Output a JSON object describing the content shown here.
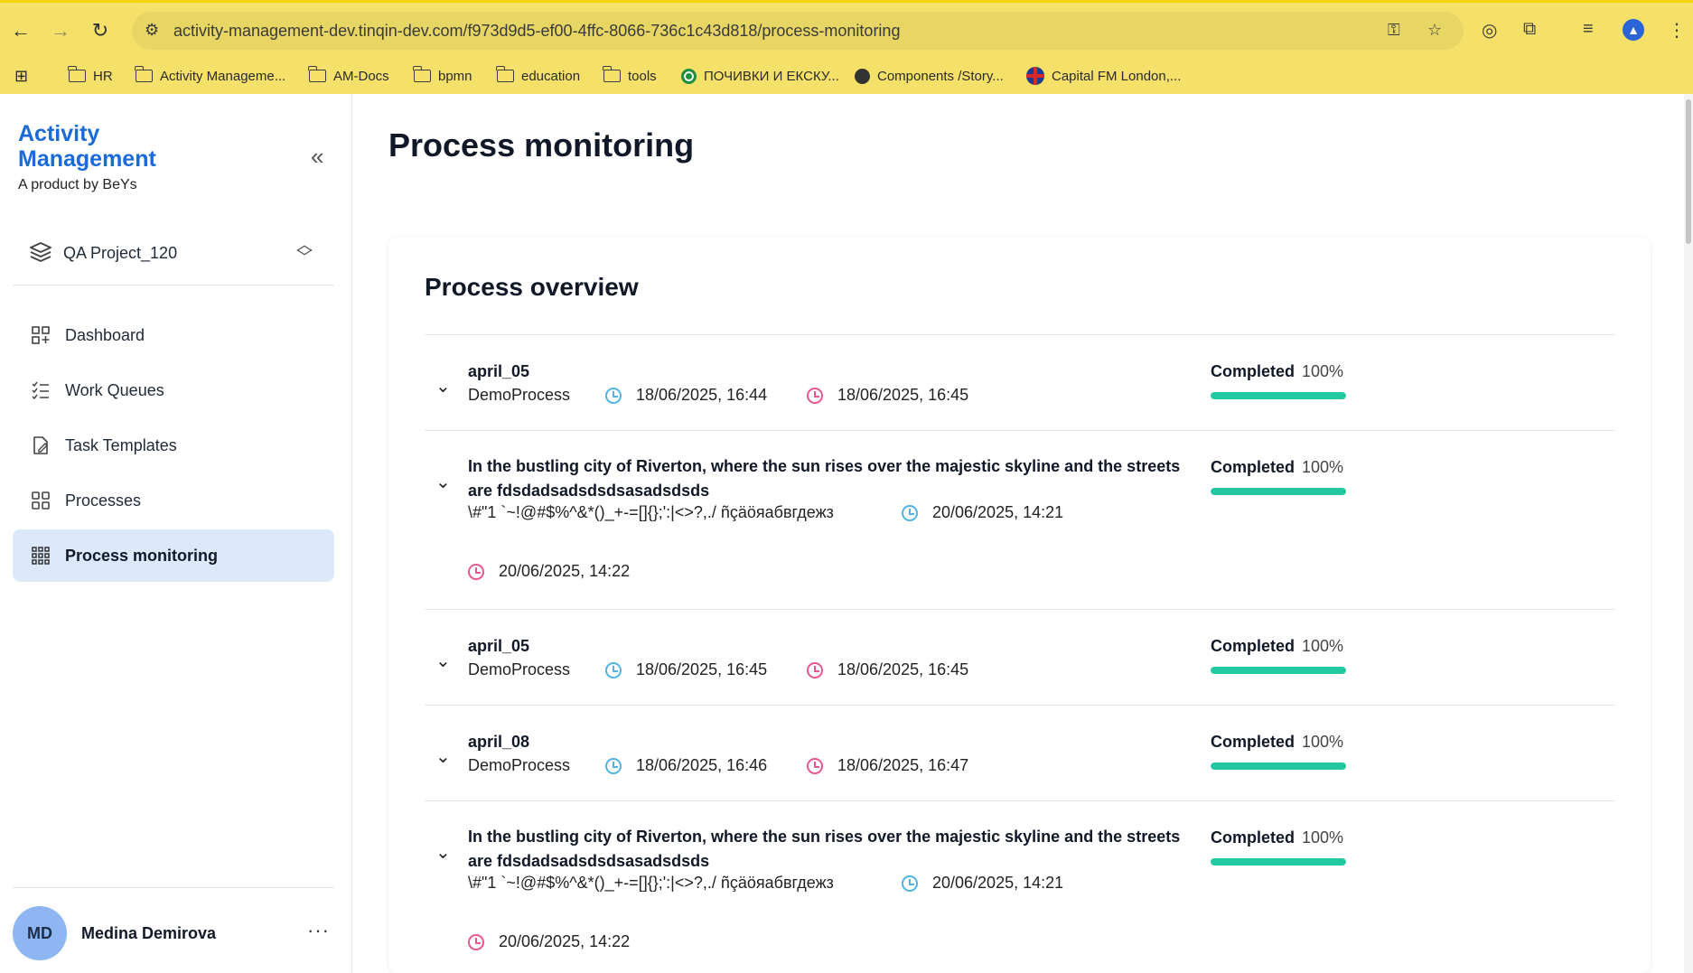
{
  "browser": {
    "url": "activity-management-dev.tinqin-dev.com/f973d9d5-ef00-4ffc-8066-736c1c43d818/process-monitoring",
    "bookmarks": [
      {
        "label": "HR",
        "icon": "folder-icon"
      },
      {
        "label": "Activity Manageme...",
        "icon": "folder-icon"
      },
      {
        "label": "AM-Docs",
        "icon": "folder-icon"
      },
      {
        "label": "bpmn",
        "icon": "folder-icon"
      },
      {
        "label": "education",
        "icon": "folder-icon"
      },
      {
        "label": "tools",
        "icon": "folder-icon"
      },
      {
        "label": "ПОЧИВКИ И ЕКСКУ...",
        "icon": "site-icon"
      },
      {
        "label": "Components /Story...",
        "icon": "globe-icon"
      },
      {
        "label": "Capital FM London,...",
        "icon": "flag-icon"
      }
    ]
  },
  "sidebar": {
    "brand_title": "Activity Management",
    "brand_subtitle": "A product by BeYs",
    "project": "QA Project_120",
    "items": [
      {
        "label": "Dashboard",
        "icon": "dashboard-icon"
      },
      {
        "label": "Work Queues",
        "icon": "list-icon"
      },
      {
        "label": "Task Templates",
        "icon": "template-icon"
      },
      {
        "label": "Processes",
        "icon": "grid-icon"
      },
      {
        "label": "Process monitoring",
        "icon": "grid-dots-icon",
        "active": true
      }
    ],
    "user": {
      "initials": "MD",
      "name": "Medina Demirova"
    }
  },
  "main": {
    "title": "Process monitoring",
    "card_title": "Process overview",
    "rows": [
      {
        "title": "april_05",
        "process": "DemoProcess",
        "start": "18/06/2025, 16:44",
        "end": "18/06/2025, 16:45",
        "status": "Completed",
        "percent": "100%",
        "progress": 1.0
      },
      {
        "title": "In the bustling city of Riverton, where the sun rises over the majestic skyline and the streets are fdsdadsadsdsdsasadsdsds",
        "process": "\\#\"1 `~!@#$%^&*()_+-=[]{};':|<>?,./ ñçäöяабвгдежз",
        "start": "20/06/2025, 14:21",
        "end": "20/06/2025, 14:22",
        "status": "Completed",
        "percent": "100%",
        "progress": 1.0
      },
      {
        "title": "april_05",
        "process": "DemoProcess",
        "start": "18/06/2025, 16:45",
        "end": "18/06/2025, 16:45",
        "status": "Completed",
        "percent": "100%",
        "progress": 1.0
      },
      {
        "title": "april_08",
        "process": "DemoProcess",
        "start": "18/06/2025, 16:46",
        "end": "18/06/2025, 16:47",
        "status": "Completed",
        "percent": "100%",
        "progress": 1.0
      },
      {
        "title": "In the bustling city of Riverton, where the sun rises over the majestic skyline and the streets are fdsdadsadsdsdsasadsdsds",
        "process": "\\#\"1 `~!@#$%^&*()_+-=[]{};':|<>?,./ ñçäöяабвгдежз",
        "start": "20/06/2025, 14:21",
        "end": "20/06/2025, 14:22",
        "status": "Completed",
        "percent": "100%",
        "progress": 1.0
      }
    ]
  },
  "colors": {
    "accent": "#1a6ad8",
    "progress": "#22c9a0",
    "start_clock": "#4fb3e8",
    "end_clock": "#e8568f",
    "active_nav": "#dce9fb",
    "chrome": "#f5e16a"
  }
}
